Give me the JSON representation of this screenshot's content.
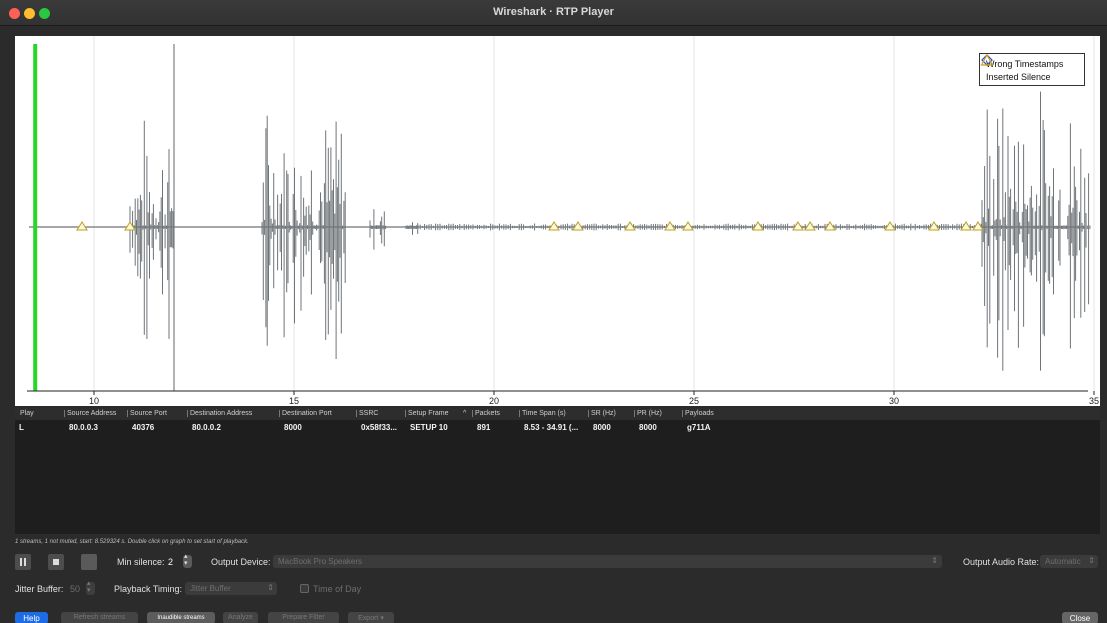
{
  "window": {
    "title": "Wireshark · RTP Player"
  },
  "legend": {
    "wrong_timestamps": "Wrong Timestamps",
    "inserted_silence": "Inserted Silence"
  },
  "chart_data": {
    "type": "line",
    "x_ticks": [
      10,
      15,
      20,
      25,
      30,
      35
    ],
    "x_range": [
      8.3,
      35.0
    ],
    "playback_position_s": 8.53,
    "cursor_s": 12.0,
    "marker_times_s": [
      9.7,
      10.9,
      21.5,
      22.1,
      23.4,
      24.4,
      24.85,
      26.6,
      27.6,
      27.9,
      28.4,
      29.9,
      31.0,
      31.8,
      32.1
    ],
    "bursts": [
      {
        "start": 10.9,
        "end": 12.0,
        "amp": 0.75
      },
      {
        "start": 14.2,
        "end": 16.3,
        "amp": 0.85
      },
      {
        "start": 16.9,
        "end": 17.3,
        "amp": 0.15
      },
      {
        "start": 17.8,
        "end": 18.1,
        "amp": 0.06
      },
      {
        "start": 32.2,
        "end": 34.9,
        "amp": 0.95
      }
    ],
    "colors": {
      "waveform": "#6f7478",
      "playhead": "#27d627",
      "cursor": "#666666",
      "grid": "#e6e6e6",
      "marker": "#b8a02a"
    }
  },
  "table": {
    "headers": [
      "Play",
      "Source Address",
      "Source Port",
      "Destination Address",
      "Destination Port",
      "SSRC",
      "Setup Frame",
      "^",
      "Packets",
      "Time Span (s)",
      "SR (Hz)",
      "PR (Hz)",
      "Payloads"
    ],
    "rows": [
      [
        "L",
        "80.0.0.3",
        "40376",
        "80.0.0.2",
        "8000",
        "0x58f33...",
        "SETUP 10",
        "",
        "891",
        "8.53 - 34.91 (...",
        "8000",
        "8000",
        "g711A"
      ]
    ]
  },
  "status": "1 streams, 1 not muted, start: 8.529324 s. Double click on graph to set start of playback.",
  "controls": {
    "min_silence_label": "Min silence:",
    "min_silence_value": "2",
    "output_device_label": "Output Device:",
    "output_device_value": "MacBook Pro Speakers",
    "output_rate_label": "Output Audio Rate:",
    "output_rate_value": "Automatic",
    "jitter_label": "Jitter Buffer:",
    "jitter_value": "50",
    "timing_label": "Playback Timing:",
    "timing_value": "Jitter Buffer",
    "time_of_day": "Time of Day"
  },
  "buttons": {
    "help": "Help",
    "refresh": "Refresh streams",
    "inaudible": "Inaudible streams",
    "analyze": "Analyze",
    "prepare_filter": "Prepare Filter",
    "export": "Export",
    "close": "Close"
  }
}
